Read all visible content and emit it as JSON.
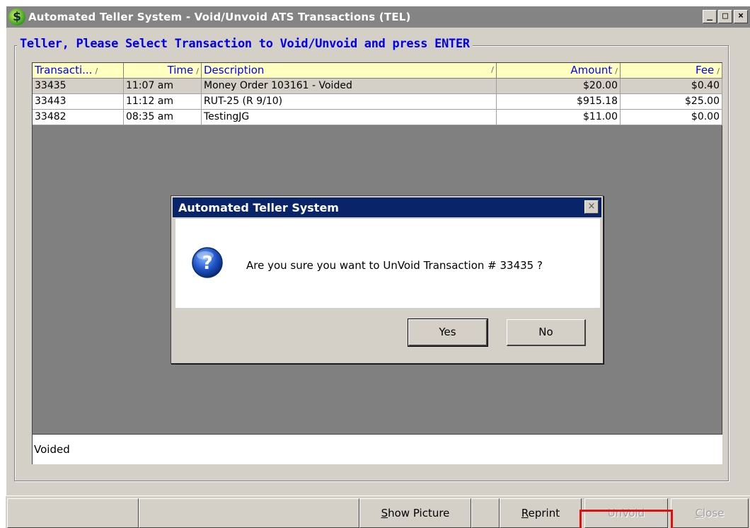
{
  "window": {
    "title": "Automated Teller System - Void/Unvoid ATS Transactions (TEL)",
    "icon": "dollar-icon",
    "controls": [
      "_",
      "□",
      "×"
    ]
  },
  "group": {
    "legend": "Teller, Please Select Transaction to Void/Unvoid and press ENTER"
  },
  "grid": {
    "headers": {
      "transaction": "Transacti...",
      "time": "Time",
      "description": "Description",
      "amount": "Amount",
      "fee": "Fee",
      "sort_glyph": "/"
    },
    "rows": [
      {
        "transaction": "33435",
        "time": "11:07 am",
        "description": "Money Order 103161 - Voided",
        "amount": "$20.00",
        "fee": "$0.40"
      },
      {
        "transaction": "33443",
        "time": "11:12 am",
        "description": "RUT-25 (R 9/10)",
        "amount": "$915.18",
        "fee": "$25.00"
      },
      {
        "transaction": "33482",
        "time": "08:35 am",
        "description": "TestingJG",
        "amount": "$11.00",
        "fee": "$0.00"
      }
    ]
  },
  "status": {
    "text": "Voided"
  },
  "dialog": {
    "title": "Automated Teller System",
    "close_glyph": "×",
    "icon": "question-icon",
    "message": "Are you sure you want to UnVoid Transaction # 33435 ?",
    "yes_label": "Yes",
    "no_label": "No"
  },
  "toolbar": {
    "show_picture_hot": "S",
    "show_picture_rest": "how Picture",
    "reprint_hot": "R",
    "reprint_rest": "eprint",
    "unvoid_label": "UnVoid",
    "close_hot": "C",
    "close_rest": "lose"
  },
  "colors": {
    "header_bg": "#ffffbf",
    "header_text": "#0000ff",
    "legend_text": "#0000ee",
    "dialog_title_bg": "#0a246a",
    "highlight": "#e01010"
  }
}
